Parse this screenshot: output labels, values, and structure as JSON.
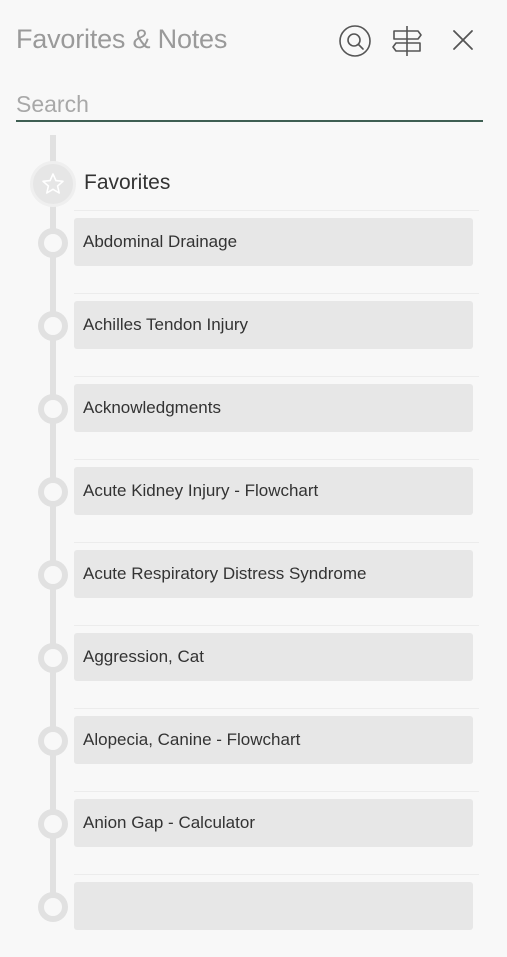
{
  "header": {
    "title": "Favorites & Notes",
    "icons": [
      "search-icon",
      "signpost-icon",
      "close-icon"
    ]
  },
  "search": {
    "placeholder": "Search",
    "value": ""
  },
  "favorites": {
    "title": "Favorites",
    "icon": "star-icon",
    "items": [
      {
        "label": "Abdominal Drainage"
      },
      {
        "label": "Achilles Tendon Injury"
      },
      {
        "label": "Acknowledgments"
      },
      {
        "label": "Acute Kidney Injury - Flowchart"
      },
      {
        "label": "Acute Respiratory Distress Syndrome"
      },
      {
        "label": "Aggression, Cat"
      },
      {
        "label": "Alopecia, Canine - Flowchart"
      },
      {
        "label": "Anion Gap - Calculator"
      },
      {
        "label": ""
      }
    ]
  },
  "colors": {
    "background": "#f8f8f8",
    "accent_underline": "#3f5f53",
    "item_background": "#e7e7e7",
    "timeline": "#e1e1e1"
  }
}
